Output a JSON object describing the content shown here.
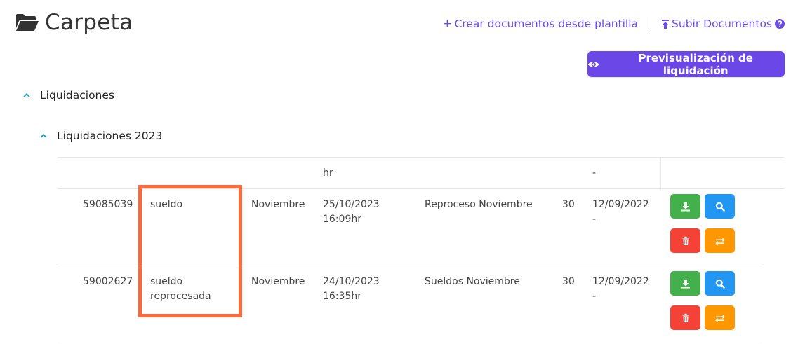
{
  "header": {
    "title": "Carpeta"
  },
  "top_links": {
    "create_label": "Crear documentos desde plantilla",
    "upload_label": "Subir Documentos"
  },
  "preview_button": {
    "label": "Previsualización de liquidación"
  },
  "tree": {
    "level1": "Liquidaciones",
    "level2": "Liquidaciones 2023"
  },
  "table": {
    "partial_row": {
      "time": "hr",
      "date_end": "-"
    },
    "rows": [
      {
        "id": "59085039",
        "type_line1": "sueldo",
        "type_line2": "",
        "month": "Noviembre",
        "date": "25/10/2023",
        "time": "16:09hr",
        "description": "Reproceso Noviembre",
        "days": "30",
        "date2": "12/09/2022",
        "date2_end": "-"
      },
      {
        "id": "59002627",
        "type_line1": "sueldo",
        "type_line2": "reprocesada",
        "month": "Noviembre",
        "date": "24/10/2023",
        "time": "16:35hr",
        "description": "Sueldos Noviembre",
        "days": "30",
        "date2": "12/09/2022",
        "date2_end": "-"
      }
    ]
  },
  "colors": {
    "accent": "#6b47e8",
    "link": "#6b4ce6",
    "tree_chevron": "#17a2b8",
    "download": "#44b04c",
    "view": "#2196f3",
    "delete": "#f44336",
    "swap": "#ff9800",
    "highlight": "#ff6a3d"
  }
}
